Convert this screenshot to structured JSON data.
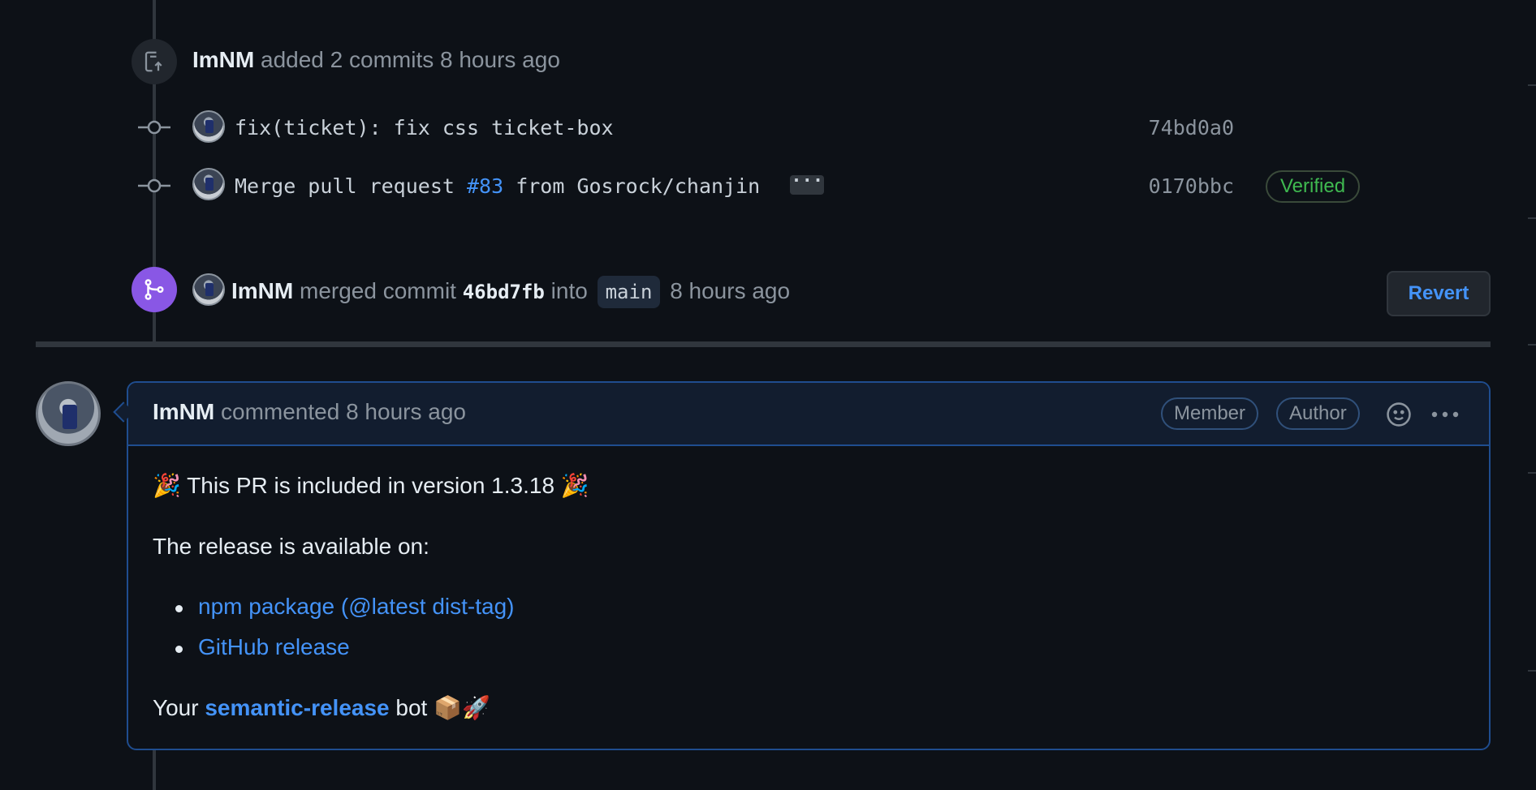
{
  "commits_event": {
    "author": "ImNM",
    "action_text": "added 2 commits 8 hours ago"
  },
  "commits": [
    {
      "message": "fix(ticket): fix css ticket-box",
      "sha": "74bd0a0"
    },
    {
      "message_prefix": "Merge pull request ",
      "pr_link": "#83",
      "message_suffix": " from Gosrock/chanjin",
      "more": "···",
      "verified": "Verified",
      "sha": "0170bbc"
    }
  ],
  "merge_event": {
    "author": "ImNM",
    "merged_text": "merged commit",
    "commit": "46bd7fb",
    "into_text": "into",
    "branch": "main",
    "time": "8 hours ago",
    "revert_label": "Revert"
  },
  "comment": {
    "author": "ImNM",
    "action": "commented 8 hours ago",
    "badges": [
      "Member",
      "Author"
    ],
    "line1_pre": "🎉 This PR is included in version 1.3.18 🎉",
    "line2": "The release is available on:",
    "links": [
      "npm package (@latest dist-tag)",
      "GitHub release"
    ],
    "line3_pre": "Your ",
    "line3_link": "semantic-release",
    "line3_post": " bot 📦🚀"
  },
  "colors": {
    "background": "#0d1117",
    "accent_link": "#4493f8",
    "merge_purple": "#8957e5",
    "verified_green": "#3fb950"
  }
}
